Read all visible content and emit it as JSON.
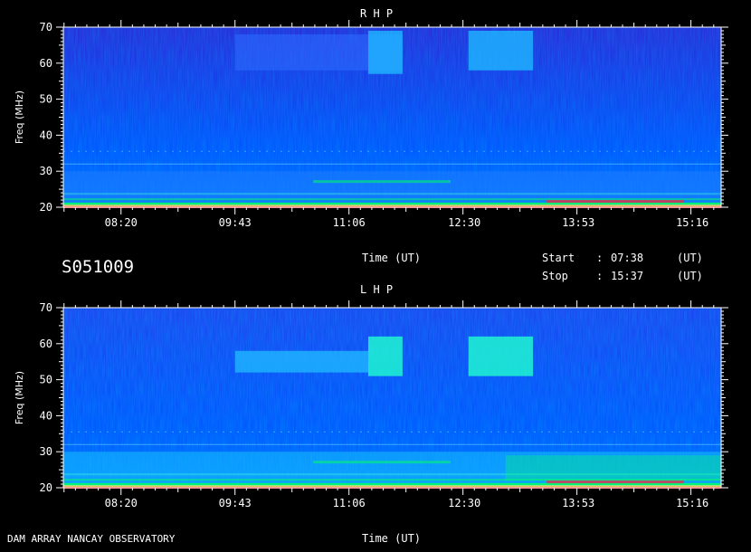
{
  "header": {
    "session_id": "S051009",
    "time_axis_label": "Time (UT)",
    "start_label": "Start",
    "start_time": "07:38",
    "stop_label": "Stop",
    "stop_time": "15:37",
    "colon": ":",
    "ut_unit": "(UT)"
  },
  "footer": {
    "credit": "DAM ARRAY  NANCAY OBSERVATORY"
  },
  "colors": {
    "background": "#000000",
    "spectrum_base": "#2b22d8",
    "spectrum_mid": "#0050ff",
    "hot_band": "#00ff66",
    "burst": "#ff2a2a"
  },
  "chart_data": [
    {
      "type": "heatmap",
      "title": "R H P",
      "ylabel": "Freq (MHz)",
      "xlabel": "Time (UT)",
      "ylim": [
        20,
        70
      ],
      "y_ticks": [
        20,
        30,
        40,
        50,
        60,
        70
      ],
      "x_ticks": [
        "08:20",
        "09:43",
        "11:06",
        "12:30",
        "13:53",
        "15:16"
      ],
      "x_range": [
        "07:38",
        "15:37"
      ],
      "emission_regions": [
        {
          "start": "09:43",
          "end": "11:45",
          "freq": [
            58,
            68
          ],
          "intensity": "low"
        },
        {
          "start": "11:20",
          "end": "11:45",
          "freq": [
            57,
            69
          ],
          "intensity": "medium"
        },
        {
          "start": "12:33",
          "end": "13:20",
          "freq": [
            58,
            69
          ],
          "intensity": "medium"
        },
        {
          "start": "07:38",
          "end": "15:37",
          "freq": [
            20,
            30
          ],
          "intensity": "high"
        }
      ]
    },
    {
      "type": "heatmap",
      "title": "L H P",
      "ylabel": "Freq (MHz)",
      "xlabel": "Time (UT)",
      "ylim": [
        20,
        70
      ],
      "y_ticks": [
        20,
        30,
        40,
        50,
        60,
        70
      ],
      "x_ticks": [
        "08:20",
        "09:43",
        "11:06",
        "12:30",
        "13:53",
        "15:16"
      ],
      "x_range": [
        "07:38",
        "15:37"
      ],
      "emission_regions": [
        {
          "start": "09:43",
          "end": "11:20",
          "freq": [
            52,
            58
          ],
          "intensity": "medium"
        },
        {
          "start": "11:20",
          "end": "11:45",
          "freq": [
            51,
            62
          ],
          "intensity": "high"
        },
        {
          "start": "12:33",
          "end": "13:20",
          "freq": [
            51,
            62
          ],
          "intensity": "high"
        },
        {
          "start": "07:38",
          "end": "15:37",
          "freq": [
            20,
            30
          ],
          "intensity": "high"
        }
      ]
    }
  ]
}
